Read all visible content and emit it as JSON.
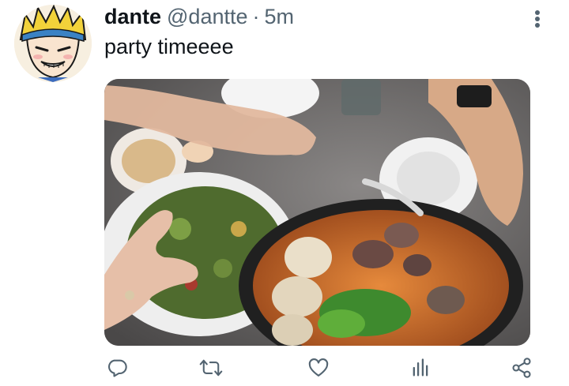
{
  "tweet": {
    "display_name": "dante",
    "handle": "@dantte",
    "separator": "·",
    "time": "5m",
    "text": "party timeeee"
  },
  "icons": {
    "avatar": "anime-avatar",
    "more": "vertical-ellipsis-icon",
    "reply": "reply-icon",
    "retweet": "retweet-icon",
    "like": "heart-icon",
    "views": "bar-chart-icon",
    "share": "share-icon"
  },
  "colors": {
    "text": "#0f1419",
    "secondary": "#536471",
    "icon": "#536471"
  }
}
